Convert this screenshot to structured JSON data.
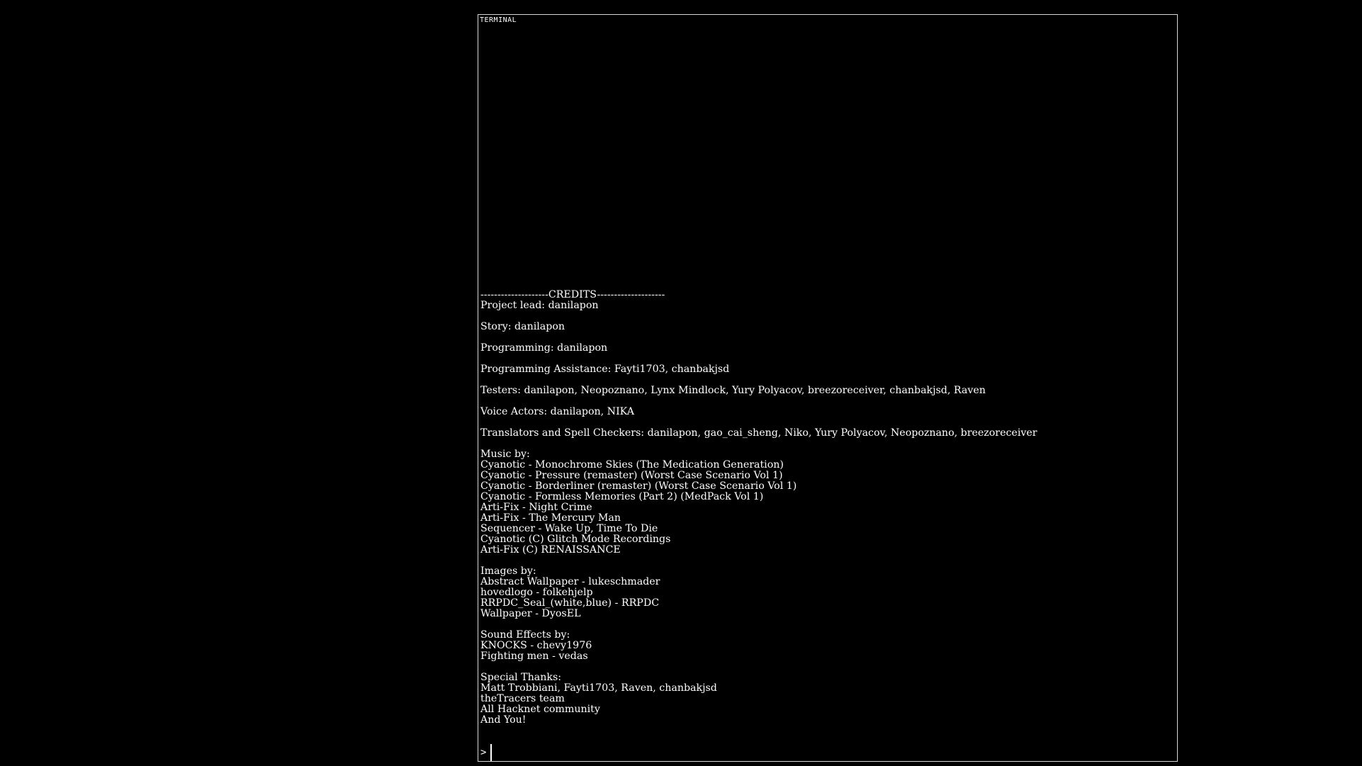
{
  "terminal": {
    "title": "TERMINAL",
    "prompt": ">",
    "input_value": "",
    "lines": [
      "--------------------CREDITS--------------------",
      "Project lead: danilapon",
      "",
      "Story: danilapon",
      "",
      "Programming: danilapon",
      "",
      "Programming Assistance: Fayti1703, chanbakjsd",
      "",
      "Testers: danilapon, Neopoznano, Lynx Mindlock, Yury Polyacov, breezoreceiver, chanbakjsd, Raven",
      "",
      "Voice Actors: danilapon, NIKA",
      "",
      "Translators and Spell Checkers: danilapon, gao_cai_sheng, Niko, Yury Polyacov, Neopoznano, breezoreceiver",
      "",
      "Music by:",
      "Cyanotic - Monochrome Skies (The Medication Generation)",
      "Cyanotic - Pressure (remaster) (Worst Case Scenario Vol 1)",
      "Cyanotic - Borderliner (remaster) (Worst Case Scenario Vol 1)",
      "Cyanotic - Formless Memories (Part 2) (MedPack Vol 1)",
      "Arti-Fix - Night Crime",
      "Arti-Fix - The Mercury Man",
      "Sequencer - Wake Up, Time To Die",
      "Cyanotic (C) Glitch Mode Recordings",
      "Arti-Fix (C) RENAISSANCE",
      "",
      "Images by:",
      "Abstract Wallpaper - lukeschmader",
      "hovedlogo - folkehjelp",
      "RRPDC_Seal_(white,blue) - RRPDC",
      "Wallpaper - DyosEL",
      "",
      "Sound Effects by:",
      "KNOCKS - chevy1976",
      "Fighting men - vedas",
      "",
      "Special Thanks:",
      "Matt Trobbiani, Fayti1703, Raven, chanbakjsd",
      "theTracers team",
      "All Hacknet community",
      "And You!"
    ]
  }
}
